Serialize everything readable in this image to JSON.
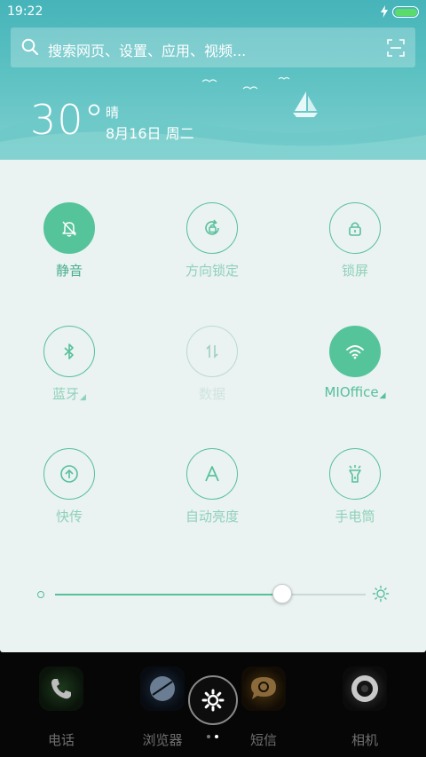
{
  "status_bar": {
    "time": "19:22",
    "battery_level": 1.0
  },
  "search": {
    "placeholder": "搜索网页、设置、应用、视频..."
  },
  "weather": {
    "temperature": "30°",
    "condition": "晴",
    "date": "8月16日 周二"
  },
  "toggles": [
    {
      "label": "静音",
      "icon": "bell-off-icon",
      "state": "active"
    },
    {
      "label": "方向锁定",
      "icon": "rotation-lock-icon",
      "state": "inactive"
    },
    {
      "label": "锁屏",
      "icon": "lock-icon",
      "state": "inactive"
    },
    {
      "label": "蓝牙",
      "icon": "bluetooth-icon",
      "state": "inactive",
      "has_menu": true
    },
    {
      "label": "数据",
      "icon": "mobile-data-icon",
      "state": "disabled"
    },
    {
      "label": "MIOffice",
      "icon": "wifi-icon",
      "state": "active",
      "has_menu": true
    },
    {
      "label": "快传",
      "icon": "share-transfer-icon",
      "state": "inactive"
    },
    {
      "label": "自动亮度",
      "icon": "auto-brightness-icon",
      "state": "inactive"
    },
    {
      "label": "手电筒",
      "icon": "flashlight-icon",
      "state": "inactive"
    }
  ],
  "menu_indicator": "◢",
  "brightness": {
    "level": 0.73
  },
  "dock": {
    "apps": [
      {
        "label": "电话",
        "icon": "phone-icon"
      },
      {
        "label": "浏览器",
        "icon": "browser-icon"
      },
      {
        "label": "短信",
        "icon": "messages-icon"
      },
      {
        "label": "相机",
        "icon": "camera-icon"
      }
    ],
    "settings_icon": "settings-gear-icon"
  },
  "colors": {
    "accent": "#56c09a",
    "header_top": "#46b4ba",
    "panel_bg": "#eaf2f2",
    "battery": "#5bdc6a"
  }
}
